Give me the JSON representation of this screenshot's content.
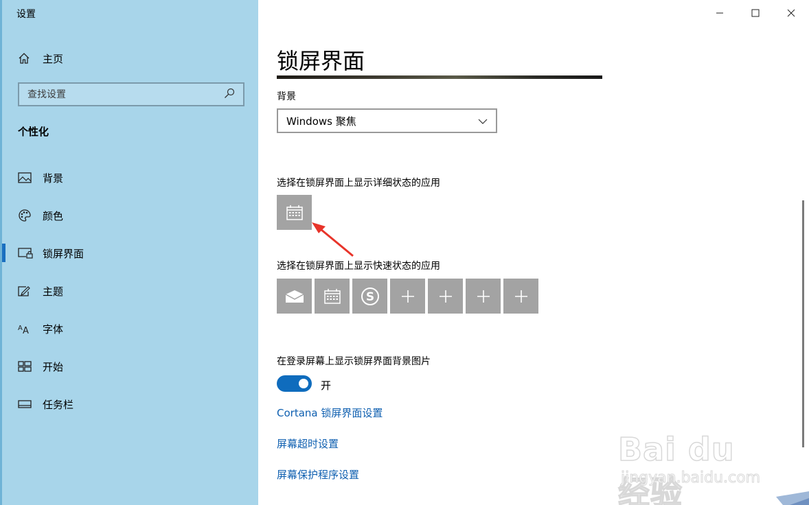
{
  "window": {
    "app_title": "设置"
  },
  "sidebar": {
    "home_label": "主页",
    "search_placeholder": "查找设置",
    "section_title": "个性化",
    "items": [
      {
        "label": "背景",
        "icon": "image-icon"
      },
      {
        "label": "颜色",
        "icon": "palette-icon"
      },
      {
        "label": "锁屏界面",
        "icon": "lock-screen-icon",
        "active": true
      },
      {
        "label": "主题",
        "icon": "theme-icon"
      },
      {
        "label": "字体",
        "icon": "font-icon"
      },
      {
        "label": "开始",
        "icon": "start-icon"
      },
      {
        "label": "任务栏",
        "icon": "taskbar-icon"
      }
    ]
  },
  "main": {
    "page_title": "锁屏界面",
    "background_label": "背景",
    "background_value": "Windows 聚焦",
    "detailed_status_label": "选择在锁屏界面上显示详细状态的应用",
    "quick_status_label": "选择在锁屏界面上显示快速状态的应用",
    "quick_status_apps": [
      "mail-icon",
      "calendar-icon",
      "skype-icon",
      "add-icon",
      "add-icon",
      "add-icon",
      "add-icon"
    ],
    "signin_bg_label": "在登录屏幕上显示锁屏界面背景图片",
    "toggle_state": "开",
    "links": [
      "Cortana 锁屏界面设置",
      "屏幕超时设置",
      "屏幕保护程序设置"
    ]
  },
  "watermark": {
    "logo": "Bai du 经验",
    "sub": "jingyan.baidu.com"
  },
  "colors": {
    "sidebar_bg": "#a8d5ea",
    "accent": "#0f6cbd",
    "link": "#0e5fb0",
    "tile": "#a3a3a3",
    "arrow": "#e8342a"
  }
}
